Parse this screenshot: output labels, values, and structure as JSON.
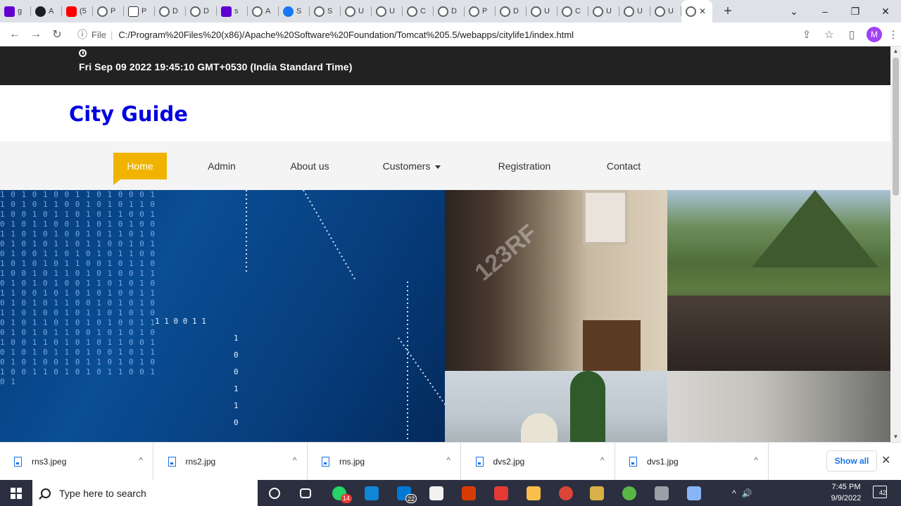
{
  "browser": {
    "tabs": [
      {
        "letter": "g",
        "favicon": "yahoo-icon",
        "color": "#6001d2"
      },
      {
        "letter": "A",
        "favicon": "github-icon",
        "color": "#1b1f23"
      },
      {
        "letter": "(5",
        "favicon": "youtube-icon",
        "color": "#ff0000"
      },
      {
        "letter": "P",
        "favicon": "globe-icon",
        "color": "#5f6368"
      },
      {
        "letter": "P",
        "favicon": "wa-icon",
        "color": "#333333"
      },
      {
        "letter": "D",
        "favicon": "globe-icon",
        "color": "#5f6368"
      },
      {
        "letter": "D",
        "favicon": "globe-icon",
        "color": "#5f6368"
      },
      {
        "letter": "s",
        "favicon": "yahoo-icon",
        "color": "#6001d2"
      },
      {
        "letter": "A",
        "favicon": "globe-icon",
        "color": "#5f6368"
      },
      {
        "letter": "S",
        "favicon": "facebook-icon",
        "color": "#1877f2"
      },
      {
        "letter": "S",
        "favicon": "globe-icon",
        "color": "#5f6368"
      },
      {
        "letter": "U",
        "favicon": "globe-icon",
        "color": "#5f6368"
      },
      {
        "letter": "U",
        "favicon": "globe-icon",
        "color": "#5f6368"
      },
      {
        "letter": "C",
        "favicon": "globe-icon",
        "color": "#5f6368"
      },
      {
        "letter": "D",
        "favicon": "globe-icon",
        "color": "#5f6368"
      },
      {
        "letter": "P",
        "favicon": "globe-icon",
        "color": "#5f6368"
      },
      {
        "letter": "D",
        "favicon": "globe-icon",
        "color": "#5f6368"
      },
      {
        "letter": "U",
        "favicon": "globe-icon",
        "color": "#5f6368"
      },
      {
        "letter": "C",
        "favicon": "globe-icon",
        "color": "#5f6368"
      },
      {
        "letter": "U",
        "favicon": "globe-icon",
        "color": "#5f6368"
      },
      {
        "letter": "U",
        "favicon": "globe-icon",
        "color": "#5f6368"
      },
      {
        "letter": "U",
        "favicon": "globe-icon",
        "color": "#5f6368"
      }
    ],
    "active_tab_close": "✕",
    "new_tab": "+",
    "window_controls": {
      "dropdown": "⌄",
      "minimize": "–",
      "restore": "❐",
      "close": "✕"
    },
    "nav": {
      "back": "←",
      "forward": "→",
      "reload": "↻"
    },
    "address": {
      "info_icon": "ⓘ",
      "scheme_label": "File",
      "separator": "|",
      "url": "C:/Program%20Files%20(x86)/Apache%20Software%20Foundation/Tomcat%205.5/webapps/citylife1/index.html"
    },
    "toolbar_icons": {
      "share": "⇪",
      "bookmark": "☆",
      "sidepanel": "▯",
      "profile_initial": "M",
      "menu": "⋮"
    }
  },
  "site": {
    "datetime": "Fri Sep 09 2022 19:45:10 GMT+0530 (India Standard Time)",
    "brand": "City Guide",
    "nav": [
      {
        "label": "Home",
        "active": true
      },
      {
        "label": "Admin",
        "active": false
      },
      {
        "label": "About us",
        "active": false
      },
      {
        "label": "Customers",
        "active": false,
        "dropdown": true
      },
      {
        "label": "Registration",
        "active": false
      },
      {
        "label": "Contact",
        "active": false
      }
    ],
    "hero_binary": "1 0 1 0 1 0 0 1 1 0 1 0 0 0 1 1 0 1 0 1 1 0 0 1 0 1 0 1 1 0 1 0 0 1 0 1 1 0 1 0 1 1 0 0 1 0 1 0 1 1 0 0 1 1 0 1 0 1 0 0 1 1 0 1 0 1 0 0 1 0 1 1 0 1 0 0 1 0 1 0 1 1 0 1 1 0 0 1 0 1 0 1 0 0 1 1 0 1 0 1 0 1 1 0 0 1 0 1 0 1 0 1 1 0 0 1 0 1 1 0 1 0 0 1 0 1 1 0 1 0 1 0 0 1 1 0 1 0 1 0 1 0 0 1 1 0 1 0 1 0 1 1 0 0 1 0 1 0 1 0 1 0 0 1 1 0 1 0 1 0 1 1 0 0 1 0 1 0 1 0 1 1 0 1 0 0 1 0 1 1 0 1 0 1 0 0 1 0 1 1 0 1 0 1 0 1 0 0 1 1 0 1 0 1 0 1 1 0 0 1 0 1 0 1 0 1 0 0 1 1 0 1 0 1 0 1 1 0 0 1 0 1 0 1 0 1 1 0 1 0 0 1 0 1 1 0 1 0 1 0 0 1 0 1 1 0 1 0 1 0 1 0 0 1 1 0 1 0 1 0 1 1 0 0 1 0 1",
    "hero_binary_row": "1  1  0  0  1  1",
    "hero_binary_col": [
      "1",
      "0",
      "0",
      "1",
      "1",
      "0"
    ],
    "watermark": "123RF"
  },
  "downloads": {
    "items": [
      {
        "name": "rns3.jpeg"
      },
      {
        "name": "rns2.jpg"
      },
      {
        "name": "rns.jpg"
      },
      {
        "name": "dvs2.jpg"
      },
      {
        "name": "dvs1.jpg"
      }
    ],
    "caret": "^",
    "show_all": "Show all",
    "close": "✕"
  },
  "taskbar": {
    "search_placeholder": "Type here to search",
    "apps": [
      {
        "name": "cortana-icon",
        "color": "#ffffff"
      },
      {
        "name": "task-view-icon",
        "color": "#ffffff"
      },
      {
        "name": "whatsapp-icon",
        "color": "#25d366",
        "badge": "14"
      },
      {
        "name": "edge-icon",
        "color": "#0f86d6"
      },
      {
        "name": "mail-icon",
        "color": "#0078d4",
        "badge": "22"
      },
      {
        "name": "store-icon",
        "color": "#f1f1f1"
      },
      {
        "name": "office-icon",
        "color": "#d83b01"
      },
      {
        "name": "pdf-icon",
        "color": "#e53935"
      },
      {
        "name": "explorer-icon",
        "color": "#f8c04a"
      },
      {
        "name": "chrome-icon",
        "color": "#db4437"
      },
      {
        "name": "notes-icon",
        "color": "#d8b048"
      },
      {
        "name": "evernote-icon",
        "color": "#57b846"
      },
      {
        "name": "tool-icon",
        "color": "#9aa0a6"
      },
      {
        "name": "book-icon",
        "color": "#8ab4f8"
      }
    ],
    "tray": {
      "chevron": "^",
      "volume": "🔊",
      "time": "7:45 PM",
      "date": "9/9/2022",
      "notifications": "42"
    }
  }
}
